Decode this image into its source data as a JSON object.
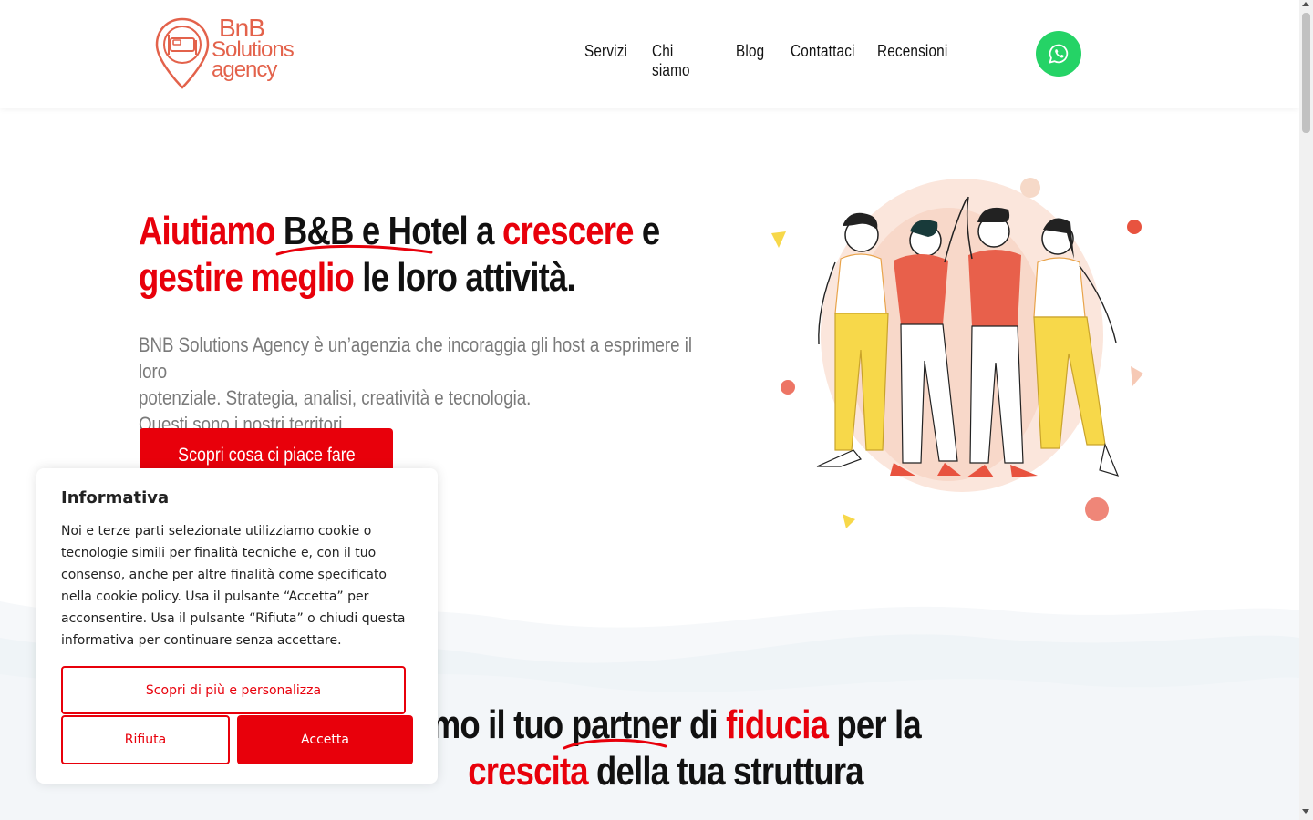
{
  "header": {
    "logo": {
      "line1": "BnB",
      "line2": "Solutions",
      "line3": "agency"
    },
    "nav": [
      {
        "label": "Servizi"
      },
      {
        "label": "Chi siamo"
      },
      {
        "label": "Blog"
      },
      {
        "label": "Contattaci"
      },
      {
        "label": "Recensioni"
      }
    ],
    "whatsapp_icon": "whatsapp-icon"
  },
  "hero": {
    "title": {
      "p1": "Aiutiamo",
      "p2": "B&B e Hotel",
      "p3": "a",
      "p4": "crescere",
      "p5": "e",
      "p6": "gestire meglio",
      "p7": "le loro attività."
    },
    "description_line1": "BNB Solutions Agency è un’agenzia che incoraggia gli host a esprimere il loro",
    "description_line2": "potenziale. Strategia, analisi, creatività e tecnologia.",
    "description_line3": "Questi sono i nostri territori.",
    "cta_label": "Scopri cosa ci piace fare"
  },
  "partner": {
    "p1": "mo il tuo",
    "p2": "partner",
    "p3": "di",
    "p4": "fiducia",
    "p5": "per la",
    "p6": "crescita",
    "p7": "della tua struttura"
  },
  "cookie": {
    "title": "Informativa",
    "text": "Noi e terze parti selezionate utilizziamo cookie o tecnologie simili per finalità tecniche e, con il tuo consenso, anche  per altre finalità come specificato nella cookie policy. Usa il pulsante “Accetta” per acconsentire. Usa il pulsante “Rifiuta” o chiudi questa informativa per continuare senza accettare.",
    "more_label": "Scopri di più e personalizza",
    "reject_label": "Rifiuta",
    "accept_label": "Accetta"
  },
  "colors": {
    "brand_red": "#e8000b",
    "logo_coral": "#e3624b",
    "whatsapp_green": "#25d366"
  }
}
